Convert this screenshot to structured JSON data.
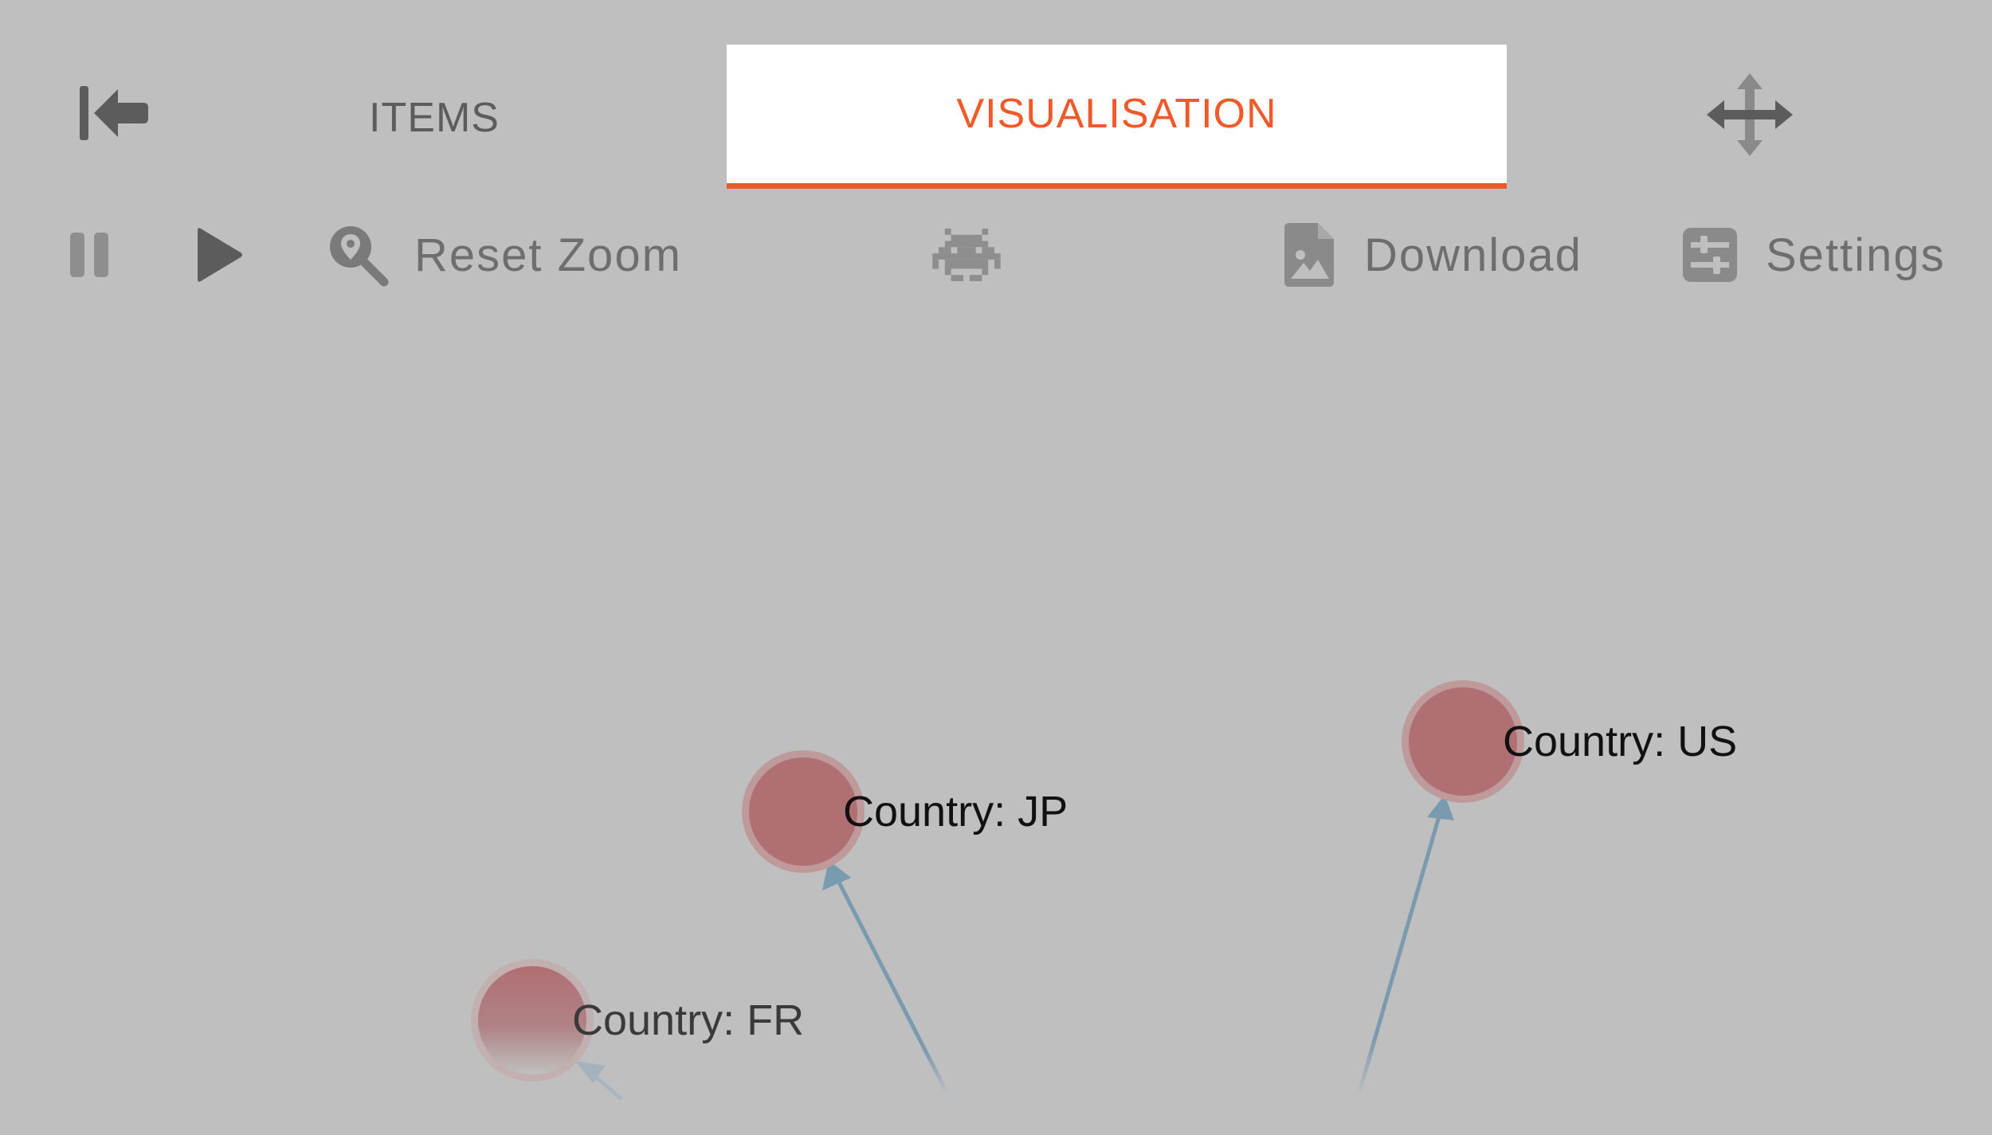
{
  "tabs": {
    "items_label": "ITEMS",
    "visualisation_label": "VISUALISATION",
    "active": "visualisation"
  },
  "toolbar": {
    "reset_zoom_label": "Reset Zoom",
    "download_label": "Download",
    "settings_label": "Settings"
  },
  "graph": {
    "nodes": [
      {
        "id": "jp",
        "label": "Country: JP"
      },
      {
        "id": "us",
        "label": "Country: US"
      },
      {
        "id": "fr",
        "label": "Country: FR"
      }
    ]
  },
  "colors": {
    "background": "#bfbfbf",
    "accent": "#f0592a",
    "node_fill": "#b06f72",
    "edge": "#7a9ab0",
    "icon": "#5c5c5c"
  },
  "icons": {
    "collapse": "arrow-left-to-bar-icon",
    "move": "arrows-move-icon",
    "pause": "pause-icon",
    "play": "play-icon",
    "reset_zoom": "map-marker-magnifier-icon",
    "debug": "space-invader-icon",
    "download": "image-file-icon",
    "settings": "sliders-icon"
  }
}
